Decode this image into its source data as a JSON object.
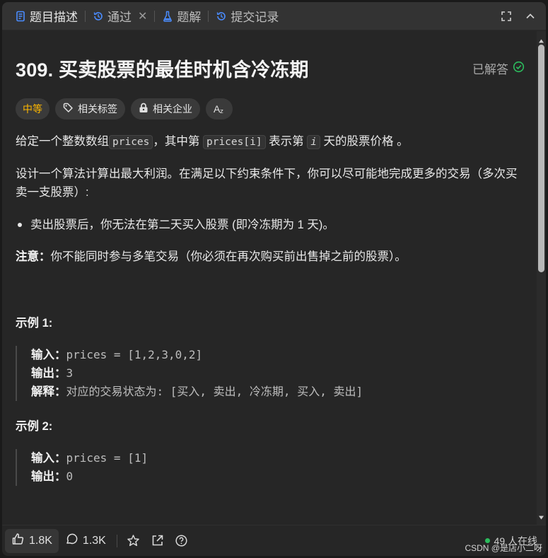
{
  "tabs": [
    {
      "label": "题目描述",
      "icon": "description-icon",
      "active": true
    },
    {
      "label": "通过",
      "icon": "history-icon",
      "closable": true
    },
    {
      "label": "题解",
      "icon": "flask-icon"
    },
    {
      "label": "提交记录",
      "icon": "history-icon"
    }
  ],
  "problem": {
    "title": "309. 买卖股票的最佳时机含冷冻期",
    "status": "已解答",
    "difficulty": "中等",
    "tags": [
      "相关标签",
      "相关企业"
    ],
    "font_toggle": "Aあ"
  },
  "description": {
    "p1_a": "给定一个整数数组",
    "p1_code1": "prices",
    "p1_b": "，其中第 ",
    "p1_code2": "prices[i]",
    "p1_c": " 表示第 ",
    "p1_code3": "i",
    "p1_d": " 天的股票价格 。",
    "p2": "设计一个算法计算出最大利润。在满足以下约束条件下，你可以尽可能地完成更多的交易（多次买卖一支股票）:",
    "bullet": "卖出股票后，你无法在第二天买入股票 (即冷冻期为 1 天)。",
    "note_label": "注意：",
    "note_text": "你不能同时参与多笔交易（你必须在再次购买前出售掉之前的股票）。"
  },
  "examples": [
    {
      "title": "示例 1:",
      "input_label": "输入：",
      "input": "prices = [1,2,3,0,2]",
      "output_label": "输出：",
      "output": "3",
      "explain_label": "解释：",
      "explain": "对应的交易状态为: [买入, 卖出, 冷冻期, 买入, 卖出]"
    },
    {
      "title": "示例 2:",
      "input_label": "输入：",
      "input": "prices = [1]",
      "output_label": "输出：",
      "output": "0"
    }
  ],
  "footer": {
    "likes": "1.8K",
    "comments": "1.3K",
    "online": "49 人在线",
    "watermark": "CSDN @是店小二呀"
  },
  "colors": {
    "difficulty": "#ffb800",
    "solved_check": "#2cbb5d",
    "online_dot": "#2cbb5d"
  }
}
